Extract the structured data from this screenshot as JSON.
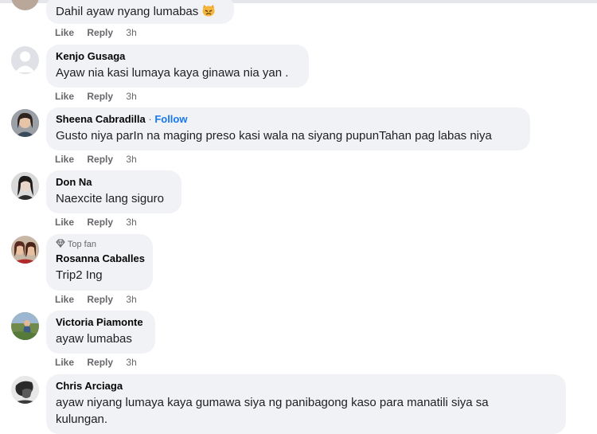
{
  "comments": [
    {
      "name": "",
      "text": "Dahil ayaw nyang lumabas",
      "emoji": "pouting-cat-emoji",
      "like": "Like",
      "reply": "Reply",
      "time": "3h"
    },
    {
      "name": "Kenjo Gusaga",
      "text": "Ayaw nia kasi lumaya kaya ginawa nia yan .",
      "like": "Like",
      "reply": "Reply",
      "time": "3h",
      "avatar": "default-avatar"
    },
    {
      "name": "Sheena Cabradilla",
      "separator": "·",
      "follow": "Follow",
      "text": "Gusto niya parIn na maging preso kasi wala na siyang pupunTahan pag labas niya",
      "like": "Like",
      "reply": "Reply",
      "time": "3h"
    },
    {
      "name": "Don Na",
      "text": "Naexcite lang siguro",
      "like": "Like",
      "reply": "Reply",
      "time": "3h"
    },
    {
      "badge": "Top fan",
      "name": "Rosanna Caballes",
      "text": "Trip2 Ing",
      "like": "Like",
      "reply": "Reply",
      "time": "3h"
    },
    {
      "name": "Victoria Piamonte",
      "text": "ayaw lumabas",
      "like": "Like",
      "reply": "Reply",
      "time": "3h"
    },
    {
      "name": "Chris Arciaga",
      "text_lines": [
        "ayaw niyang lumaya kaya gumawa siya ng panibagong kaso para manatili siya sa",
        "kulungan."
      ]
    }
  ],
  "colors": {
    "bubble": "#f0f2f5",
    "meta": "#65676b",
    "follow": "#1877f2"
  }
}
